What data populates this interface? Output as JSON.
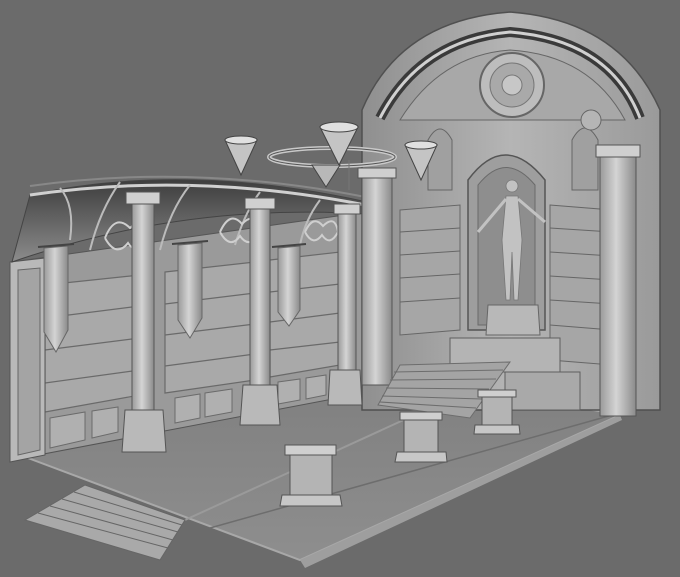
{
  "scene": {
    "kind": "untextured 3D render of a gothic library hall with a statue alcove",
    "colors": {
      "background": "#6b6b6b",
      "floor": "#8a8a8a",
      "floor_edge": "#a6a6a6",
      "wall": "#9c9c9c",
      "wall_light": "#c4c4c4",
      "wall_dark": "#5e5e5e",
      "shelf": "#b3b3b3",
      "pillar": "#bdbdbd",
      "banner": "#b8b8b8",
      "ceiling_shadow": "#3a3a3a"
    }
  }
}
